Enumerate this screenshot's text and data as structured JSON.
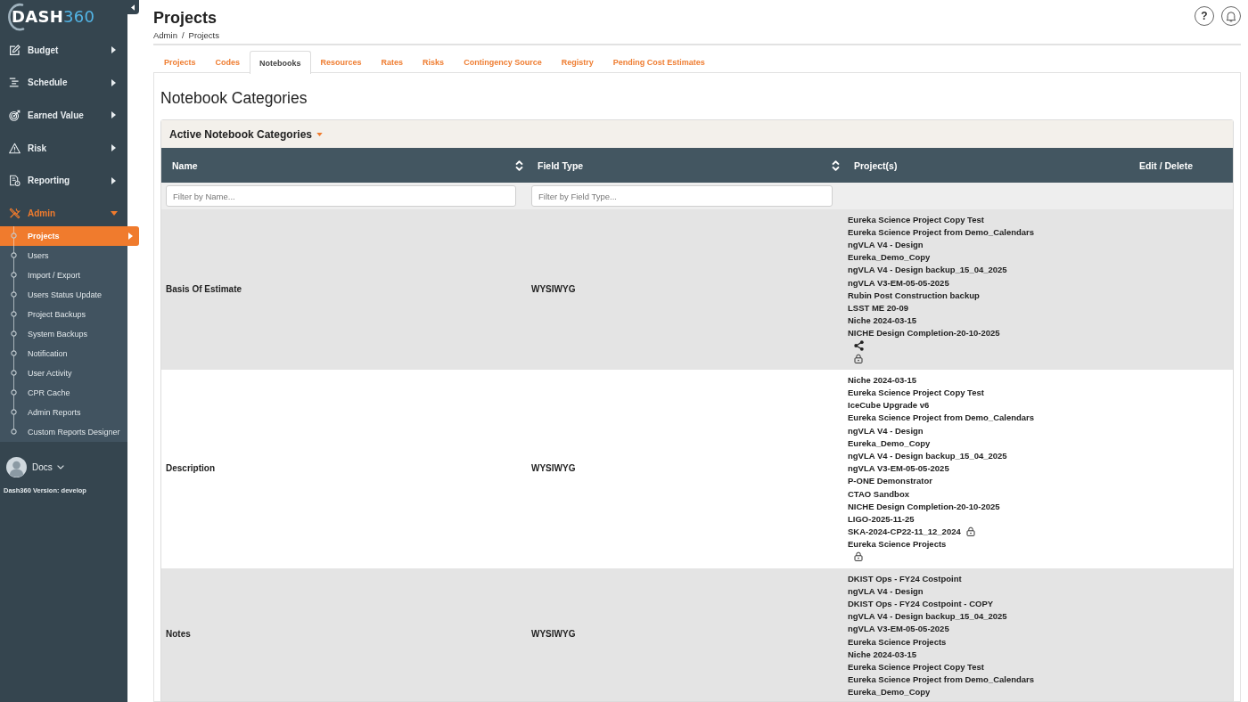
{
  "sidebar": {
    "logo": {
      "text": "DASH",
      "accent": "360"
    },
    "menu": [
      {
        "label": "Budget",
        "selected": false,
        "expanded": false
      },
      {
        "label": "Schedule",
        "selected": false,
        "expanded": false
      },
      {
        "label": "Earned Value",
        "selected": false,
        "expanded": false
      },
      {
        "label": "Risk",
        "selected": false,
        "expanded": false
      },
      {
        "label": "Reporting",
        "selected": false,
        "expanded": false
      },
      {
        "label": "Admin",
        "selected": true,
        "expanded": true,
        "children": [
          {
            "label": "Projects",
            "selected": true
          },
          {
            "label": "Users",
            "selected": false
          },
          {
            "label": "Import / Export",
            "selected": false
          },
          {
            "label": "Users Status Update",
            "selected": false
          },
          {
            "label": "Project Backups",
            "selected": false
          },
          {
            "label": "System Backups",
            "selected": false
          },
          {
            "label": "Notification",
            "selected": false
          },
          {
            "label": "User Activity",
            "selected": false
          },
          {
            "label": "CPR Cache",
            "selected": false
          },
          {
            "label": "Admin Reports",
            "selected": false
          },
          {
            "label": "Custom Reports Designer",
            "selected": false
          }
        ]
      }
    ],
    "user": {
      "name": "Docs"
    },
    "version": "Dash360 Version: develop"
  },
  "header": {
    "title": "Projects",
    "breadcrumb": [
      "Admin",
      "Projects"
    ],
    "breadcrumb_separator": "/",
    "help_label": "?"
  },
  "tabs": [
    {
      "label": "Projects",
      "selected": false
    },
    {
      "label": "Codes",
      "selected": false
    },
    {
      "label": "Notebooks",
      "selected": true
    },
    {
      "label": "Resources",
      "selected": false
    },
    {
      "label": "Rates",
      "selected": false
    },
    {
      "label": "Risks",
      "selected": false
    },
    {
      "label": "Contingency Source",
      "selected": false
    },
    {
      "label": "Registry",
      "selected": false
    },
    {
      "label": "Pending Cost Estimates",
      "selected": false
    }
  ],
  "section_title": "Notebook Categories",
  "panel": {
    "title": "Active Notebook Categories"
  },
  "table": {
    "columns": [
      {
        "label": "Name",
        "sortable": true
      },
      {
        "label": "Field Type",
        "sortable": true
      },
      {
        "label": "Project(s)",
        "sortable": false
      },
      {
        "label": "Edit / Delete",
        "sortable": false
      }
    ],
    "filters": [
      {
        "placeholder": "Filter by Name..."
      },
      {
        "placeholder": "Filter by Field Type..."
      }
    ],
    "rows": [
      {
        "name": "Basis Of Estimate",
        "field_type": "WYSIWYG",
        "shared": true,
        "locked": true,
        "projects": [
          {
            "name": "Eureka Science Project Copy Test",
            "locked": false
          },
          {
            "name": "Eureka Science Project from Demo_Calendars",
            "locked": false
          },
          {
            "name": "ngVLA V4 - Design",
            "locked": false
          },
          {
            "name": "Eureka_Demo_Copy",
            "locked": false
          },
          {
            "name": "ngVLA V4 - Design backup_15_04_2025",
            "locked": false
          },
          {
            "name": "ngVLA V3-EM-05-05-2025",
            "locked": false
          },
          {
            "name": "Rubin Post Construction backup",
            "locked": false
          },
          {
            "name": "LSST ME 20-09",
            "locked": false
          },
          {
            "name": "Niche 2024-03-15",
            "locked": false
          },
          {
            "name": "NICHE Design Completion-20-10-2025",
            "locked": false
          }
        ]
      },
      {
        "name": "Description",
        "field_type": "WYSIWYG",
        "shared": false,
        "locked": true,
        "projects": [
          {
            "name": "Niche 2024-03-15",
            "locked": false
          },
          {
            "name": "Eureka Science Project Copy Test",
            "locked": false
          },
          {
            "name": "IceCube Upgrade v6",
            "locked": false
          },
          {
            "name": "Eureka Science Project from Demo_Calendars",
            "locked": false
          },
          {
            "name": "ngVLA V4 - Design",
            "locked": false
          },
          {
            "name": "Eureka_Demo_Copy",
            "locked": false
          },
          {
            "name": "ngVLA V4 - Design backup_15_04_2025",
            "locked": false
          },
          {
            "name": "ngVLA V3-EM-05-05-2025",
            "locked": false
          },
          {
            "name": "P-ONE Demonstrator",
            "locked": false
          },
          {
            "name": "CTAO Sandbox",
            "locked": false
          },
          {
            "name": "NICHE Design Completion-20-10-2025",
            "locked": false
          },
          {
            "name": "LIGO-2025-11-25",
            "locked": false
          },
          {
            "name": "SKA-2024-CP22-11_12_2024",
            "locked": true
          },
          {
            "name": "Eureka Science Projects",
            "locked": false
          }
        ]
      },
      {
        "name": "Notes",
        "field_type": "WYSIWYG",
        "shared": false,
        "locked": false,
        "projects": [
          {
            "name": "DKIST Ops - FY24 Costpoint",
            "locked": false
          },
          {
            "name": "ngVLA V4 - Design",
            "locked": false
          },
          {
            "name": "DKIST Ops - FY24 Costpoint - COPY",
            "locked": false
          },
          {
            "name": "ngVLA V4 - Design backup_15_04_2025",
            "locked": false
          },
          {
            "name": "ngVLA V3-EM-05-05-2025",
            "locked": false
          },
          {
            "name": "Eureka Science Projects",
            "locked": false
          },
          {
            "name": "Niche 2024-03-15",
            "locked": false
          },
          {
            "name": "Eureka Science Project Copy Test",
            "locked": false
          },
          {
            "name": "Eureka Science Project from Demo_Calendars",
            "locked": false
          },
          {
            "name": "Eureka_Demo_Copy",
            "locked": false
          }
        ]
      }
    ]
  }
}
